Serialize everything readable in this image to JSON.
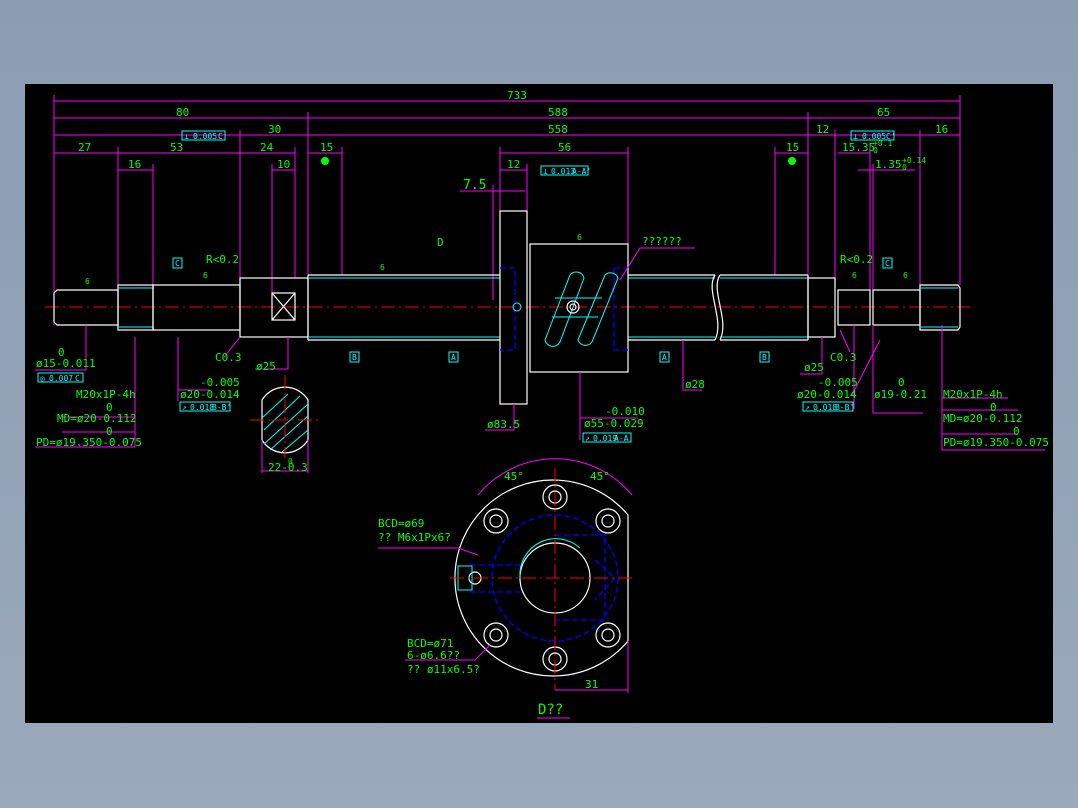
{
  "colors": {
    "background": "#000000",
    "dimension": "#ff00ff",
    "text": "#00ff00",
    "outline": "#ffffff",
    "centerline": "#ff0000",
    "hidden": "#0000ff",
    "tolerance_frame": "#00ffff"
  },
  "dims": {
    "overall": "733",
    "left_80": "80",
    "mid_588": "588",
    "right_65": "65",
    "d558": "558",
    "d30": "30",
    "d27": "27",
    "d53": "53",
    "d24": "24",
    "d15_left": "15",
    "d16_left": "16",
    "d10": "10",
    "d56": "56",
    "d12_nut": "12",
    "d7_5": "7.5",
    "d12_right": "12",
    "d16_right": "16",
    "d15_right": "15",
    "d15_35": "15.35",
    "d15_35_tol_upper": "+0.1",
    "d15_35_tol_lower": "0",
    "d1_35": "1.35",
    "d1_35_tol_upper": "+0.14",
    "d1_35_tol_lower": "0",
    "section_22": "22-0.3",
    "section_22_upper": "0",
    "d31": "31",
    "angle_left": "45°",
    "angle_right": "45°"
  },
  "tolerance_frames": {
    "perp_left": [
      "⊥",
      "0.005",
      "C"
    ],
    "perp_right": [
      "⊥",
      "0.005",
      "C'"
    ],
    "perp_nut": [
      "⊥",
      "0.013",
      "A-A'"
    ],
    "conc_left": [
      "◎",
      "0.007",
      "C"
    ],
    "runout_left": [
      "↗",
      "0.018",
      "B-B'"
    ],
    "runout_nut": [
      "↗",
      "0.019",
      "A-A'"
    ],
    "runout_right": [
      "↗",
      "0.018",
      "B-B'"
    ]
  },
  "datums": {
    "c_left": "C",
    "c_right": "C'",
    "b_left": "B",
    "b_right": "B'",
    "a_left": "A",
    "a_right": "A'"
  },
  "roughness": "6",
  "labels": {
    "r_left": "R<0.2",
    "r_right": "R<0.2",
    "c03_left": "C0.3",
    "c03_right": "C0.3",
    "phi25_left": "ø25",
    "phi25_right": "ø25",
    "phi15_upper": "0",
    "phi15": "ø15-0.011",
    "phi20_left_upper": "-0.005",
    "phi20_left": "ø20-0.014",
    "phi20_right_upper": "-0.005",
    "phi20_right": "ø20-0.014",
    "phi19_upper": "0",
    "phi19": "ø19-0.21",
    "thread_left": "M20x1P-4h",
    "md_left_upper": "0",
    "md_left": "MD=ø20-0.112",
    "pd_left_upper": "0",
    "pd_left": "PD=ø19.350-0.075",
    "thread_right": "M20x1P-4h",
    "md_right_upper": "0",
    "md_right": "MD=ø20-0.112",
    "pd_right_upper": "0",
    "pd_right": "PD=ø19.350-0.075",
    "phi83_5": "ø83.5",
    "phi55_upper": "-0.010",
    "phi55": "ø55-0.029",
    "phi28": "ø28",
    "nut_note": "??????",
    "view_marker": "D",
    "bcd69": "BCD=ø69",
    "m6": "?? M6x1Px6?",
    "bcd71": "BCD=ø71",
    "holes": "6-ø6.6??",
    "cbore": "?? ø11x6.5?",
    "view_title": "D??"
  }
}
